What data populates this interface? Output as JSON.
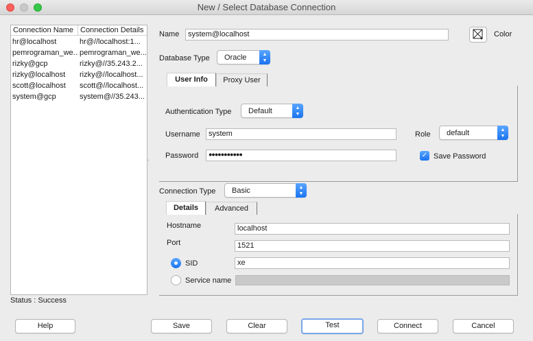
{
  "window": {
    "title": "New / Select Database Connection"
  },
  "connections": {
    "headers": [
      "Connection Name",
      "Connection Details"
    ],
    "rows": [
      {
        "name": "hr@localhost",
        "details": "hr@//localhost:1..."
      },
      {
        "name": "pemrograman_we...",
        "details": "pemrograman_we..."
      },
      {
        "name": "rizky@gcp",
        "details": "rizky@//35.243.2..."
      },
      {
        "name": "rizky@localhost",
        "details": "rizky@//localhost..."
      },
      {
        "name": "scott@localhost",
        "details": "scott@//localhost..."
      },
      {
        "name": "system@gcp",
        "details": "system@//35.243..."
      }
    ]
  },
  "status": "Status : Success",
  "form": {
    "name_label": "Name",
    "name_value": "system@localhost",
    "color_label": "Color",
    "dbtype_label": "Database Type",
    "dbtype_value": "Oracle",
    "tabs1": [
      "User Info",
      "Proxy User"
    ],
    "auth_label": "Authentication Type",
    "auth_value": "Default",
    "username_label": "Username",
    "username_value": "system",
    "role_label": "Role",
    "role_value": "default",
    "password_label": "Password",
    "password_value": "●●●●●●●●●●●",
    "save_password_label": "Save Password",
    "save_password_checked": true,
    "conntype_label": "Connection Type",
    "conntype_value": "Basic",
    "tabs2": [
      "Details",
      "Advanced"
    ],
    "hostname_label": "Hostname",
    "hostname_value": "localhost",
    "port_label": "Port",
    "port_value": "1521",
    "sid_label": "SID",
    "sid_value": "xe",
    "service_label": "Service name",
    "service_value": ""
  },
  "buttons": {
    "help": "Help",
    "save": "Save",
    "clear": "Clear",
    "test": "Test",
    "connect": "Connect",
    "cancel": "Cancel"
  },
  "icons": {
    "color_button": "color-picker-icon",
    "combo_arrow": "up-down-arrows-icon"
  }
}
